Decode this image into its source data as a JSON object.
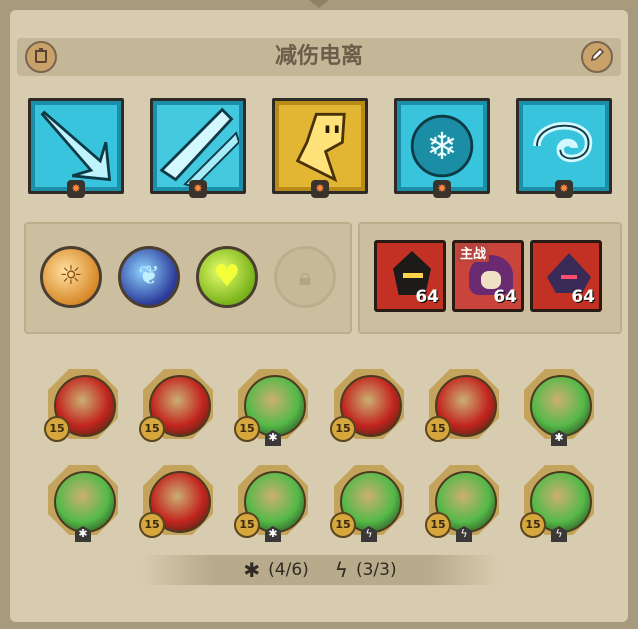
{
  "header": {
    "title": "减伤电离"
  },
  "skills": [
    {
      "name": "ice-arrow-skill",
      "color": "#1f9fb8"
    },
    {
      "name": "ice-shard-skill",
      "color": "#2aaec8"
    },
    {
      "name": "golden-spirit-skill",
      "color": "#d7a82a"
    },
    {
      "name": "snowflake-skill",
      "color": "#2ab0c9"
    },
    {
      "name": "ice-vortex-skill",
      "color": "#2ab0c9"
    }
  ],
  "heroes": [
    {
      "level": "64",
      "role": ""
    },
    {
      "level": "64",
      "role": "主战"
    },
    {
      "level": "64",
      "role": ""
    }
  ],
  "equipment": [
    {
      "level": "15",
      "core_color": "#c2241e",
      "mark": ""
    },
    {
      "level": "15",
      "core_color": "#c2241e",
      "mark": ""
    },
    {
      "level": "15",
      "core_color": "#54b948",
      "mark": "✱"
    },
    {
      "level": "15",
      "core_color": "#c2241e",
      "mark": ""
    },
    {
      "level": "15",
      "core_color": "#c2241e",
      "mark": ""
    },
    {
      "level": "",
      "core_color": "#54b948",
      "mark": "✱"
    },
    {
      "level": "",
      "core_color": "#54b948",
      "mark": "✱"
    },
    {
      "level": "15",
      "core_color": "#c2241e",
      "mark": ""
    },
    {
      "level": "15",
      "core_color": "#54b948",
      "mark": "✱"
    },
    {
      "level": "15",
      "core_color": "#54b948",
      "mark": "ϟ"
    },
    {
      "level": "15",
      "core_color": "#54b948",
      "mark": "ϟ"
    },
    {
      "level": "15",
      "core_color": "#54b948",
      "mark": "ϟ"
    }
  ],
  "footer": {
    "set1_icon": "✱",
    "set1_count": "(4/6)",
    "set2_icon": "ϟ",
    "set2_count": "(3/3)"
  }
}
